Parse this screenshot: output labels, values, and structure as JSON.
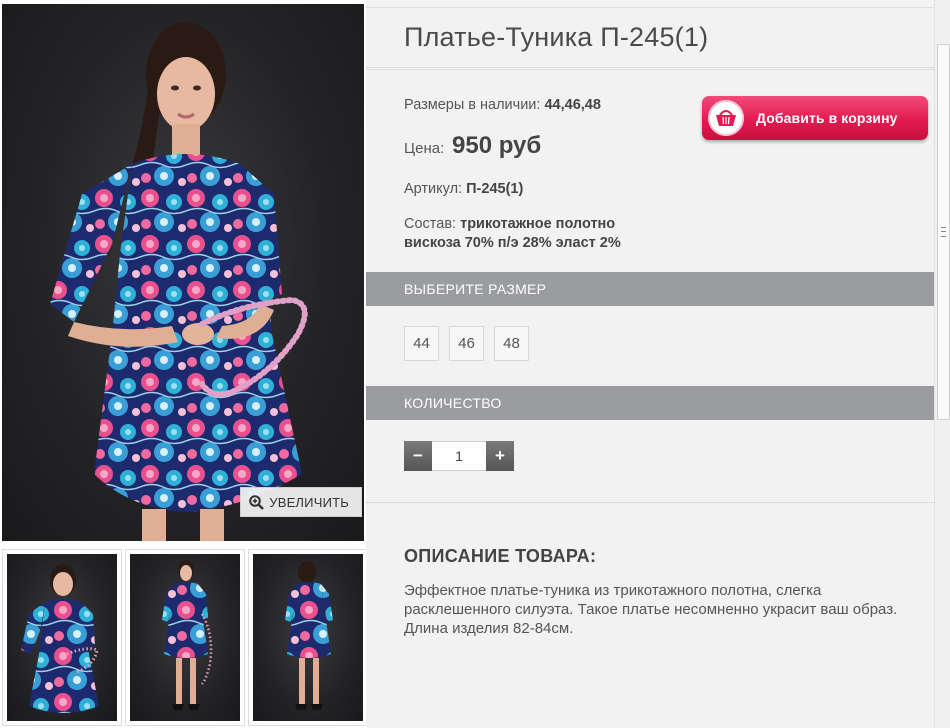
{
  "product": {
    "title": "Платье-Туника П-245(1)",
    "sizes_label": "Размеры в наличии:",
    "sizes_value": "44,46,48",
    "price_label": "Цена:",
    "price_value": "950 руб",
    "article_label": "Артикул:",
    "article_value": "П-245(1)",
    "composition_label": "Состав:",
    "composition_line1": "трикотажное полотно",
    "composition_line2": "вискоза 70% п/э 28% эласт 2%"
  },
  "cart_button": {
    "label": "Добавить в корзину",
    "icon": "basket-icon",
    "color": "#e21b50"
  },
  "gallery": {
    "zoom_label": "УВЕЛИЧИТЬ",
    "zoom_icon": "magnifier-plus-icon",
    "thumbnails": [
      "front-view",
      "full-length-front",
      "back-view"
    ]
  },
  "size_section": {
    "title": "ВЫБЕРИТЕ РАЗМЕР",
    "options": [
      "44",
      "46",
      "48"
    ]
  },
  "quantity_section": {
    "title": "КОЛИЧЕСТВО",
    "minus": "−",
    "plus": "+",
    "value": "1"
  },
  "description": {
    "title": "ОПИСАНИЕ ТОВАРА:",
    "text": "Эффектное платье-туника из трикотажного полотна, слегка расклешенного силуэта. Такое платье несомненно украсит ваш образ. Длина изделия 82-84см."
  },
  "colors": {
    "section_bar": "#9a9c9f",
    "panel_bg": "#f2f2f2",
    "accent": "#e21b50"
  }
}
